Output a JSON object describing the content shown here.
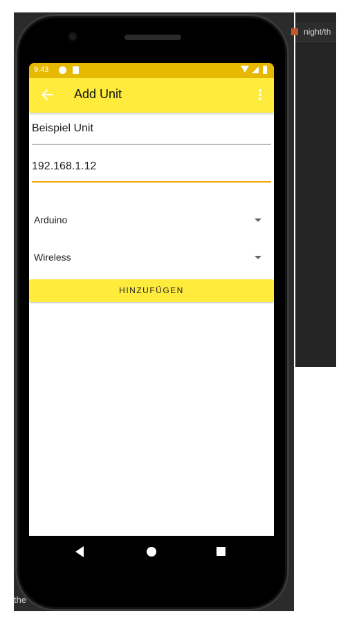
{
  "background": {
    "right_tab_text": "night/th",
    "left_text": "the"
  },
  "status_bar": {
    "time": "9:43"
  },
  "app_bar": {
    "title": "Add Unit",
    "back_icon": "arrow-left",
    "more_icon": "more-vertical"
  },
  "form": {
    "unit_name": "Beispiel Unit",
    "ip_address": "192.168.1.12",
    "device_type": "Arduino",
    "connection_type": "Wireless",
    "submit_label": "HINZUFÜGEN"
  },
  "colors": {
    "accent_yellow": "#ffeb3b",
    "status_yellow": "#e6b800",
    "focus_orange": "#f2a500"
  }
}
